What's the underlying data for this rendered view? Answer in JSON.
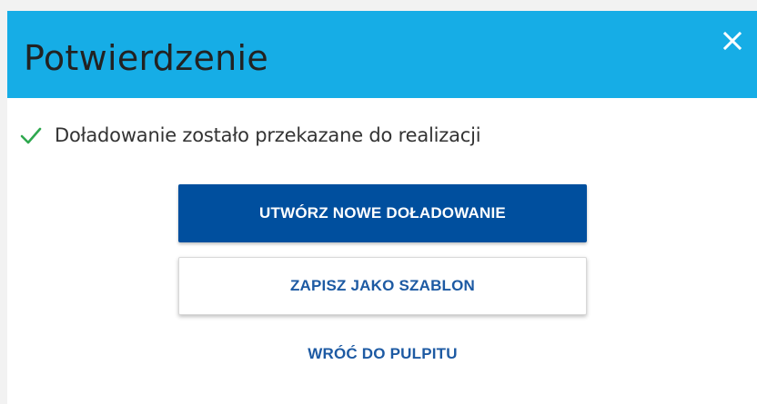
{
  "dialog": {
    "title": "Potwierdzenie",
    "close_icon": "close-icon",
    "message": {
      "icon": "check-icon",
      "icon_color": "#2fa84f",
      "text": "Doładowanie zostało przekazane do realizacji"
    },
    "actions": {
      "primary_label": "UTWÓRZ NOWE DOŁADOWANIE",
      "secondary_label": "ZAPISZ JAKO SZABLON",
      "link_label": "WRÓĆ DO PULPITU"
    }
  },
  "colors": {
    "header_bg": "#16ade6",
    "primary_bg": "#004f9e",
    "link_text": "#1d5aa3"
  }
}
